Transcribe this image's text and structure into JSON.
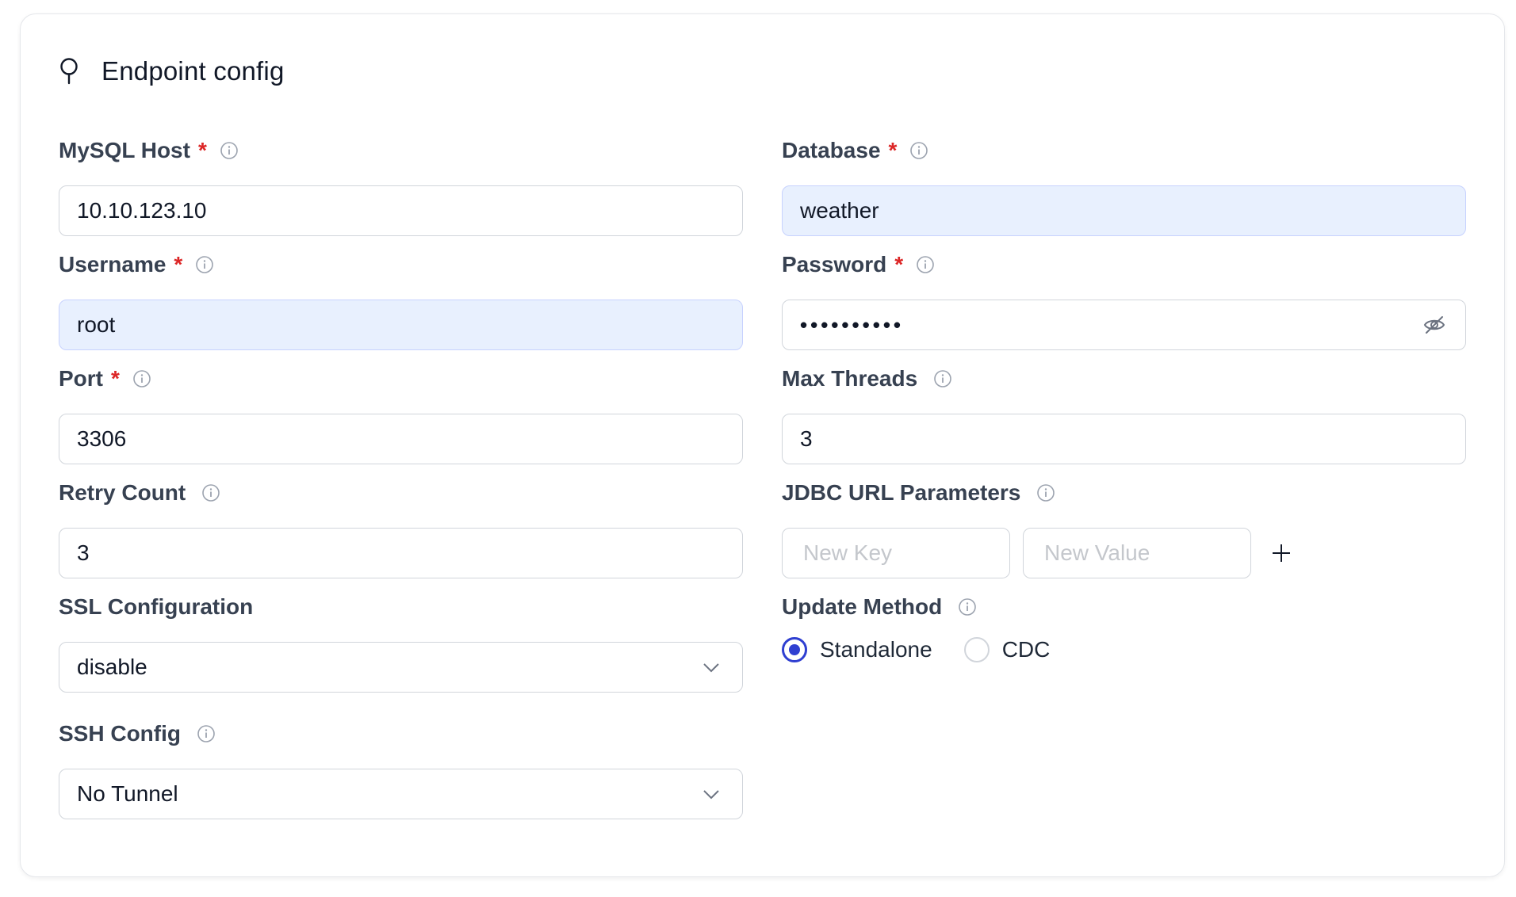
{
  "card": {
    "title": "Endpoint config",
    "icon": "pin-icon"
  },
  "fields": {
    "mysql_host": {
      "label": "MySQL Host",
      "required": "*",
      "value": "10.10.123.10"
    },
    "database": {
      "label": "Database",
      "required": "*",
      "value": "weather"
    },
    "username": {
      "label": "Username",
      "required": "*",
      "value": "root"
    },
    "password": {
      "label": "Password",
      "required": "*",
      "value": "••••••••••"
    },
    "port": {
      "label": "Port",
      "required": "*",
      "value": "3306"
    },
    "max_threads": {
      "label": "Max Threads",
      "value": "3"
    },
    "retry_count": {
      "label": "Retry Count",
      "value": "3"
    },
    "jdbc": {
      "label": "JDBC URL Parameters",
      "key_placeholder": "New Key",
      "value_placeholder": "New Value"
    },
    "ssl": {
      "label": "SSL Configuration",
      "value": "disable"
    },
    "update_method": {
      "label": "Update Method",
      "options": [
        "Standalone",
        "CDC"
      ],
      "selected": "Standalone"
    },
    "ssh": {
      "label": "SSH Config",
      "value": "No Tunnel"
    }
  },
  "colors": {
    "accent": "#2f3fd1",
    "required": "#dc2626",
    "autofill_bg": "#e8f0fe",
    "border": "#d1d5db"
  }
}
